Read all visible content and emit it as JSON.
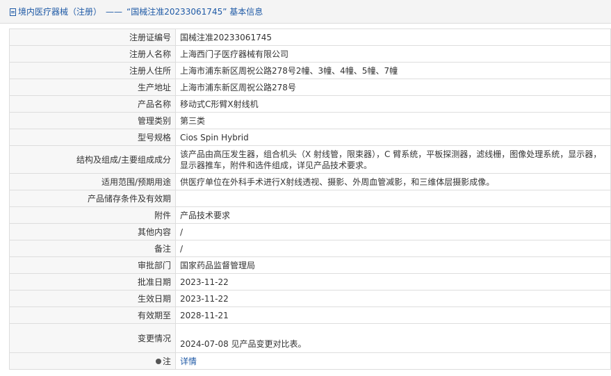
{
  "header": {
    "prefix": "境内医疗器械（注册）",
    "separator": "——",
    "title": "“国械注准20233061745” 基本信息"
  },
  "rows": [
    {
      "label": "注册证编号",
      "value": "国械注准20233061745"
    },
    {
      "label": "注册人名称",
      "value": "上海西门子医疗器械有限公司"
    },
    {
      "label": "注册人住所",
      "value": "上海市浦东新区周祝公路278号2幢、3幢、4幢、5幢、7幢"
    },
    {
      "label": "生产地址",
      "value": "上海市浦东新区周祝公路278号"
    },
    {
      "label": "产品名称",
      "value": "移动式C形臂X射线机"
    },
    {
      "label": "管理类别",
      "value": "第三类"
    },
    {
      "label": "型号规格",
      "value": "Cios Spin Hybrid"
    },
    {
      "label": "结构及组成/主要组成成分",
      "value": "该产品由高压发生器，组合机头（X 射线管，限束器），C 臂系统，平板探测器，滤线栅，图像处理系统，显示器，显示器推车，附件和选件组成，详见产品技术要求。"
    },
    {
      "label": "适用范围/预期用途",
      "value": "供医疗单位在外科手术进行X射线透视、摄影、外周血管减影，和三维体层摄影成像。"
    },
    {
      "label": "产品储存条件及有效期",
      "value": ""
    },
    {
      "label": "附件",
      "value": "产品技术要求"
    },
    {
      "label": "其他内容",
      "value": "/"
    },
    {
      "label": "备注",
      "value": "/"
    },
    {
      "label": "审批部门",
      "value": "国家药品监督管理局"
    },
    {
      "label": "批准日期",
      "value": "2023-11-22"
    },
    {
      "label": "生效日期",
      "value": "2023-11-22"
    },
    {
      "label": "有效期至",
      "value": "2028-11-21"
    },
    {
      "label": "变更情况",
      "value": "2024-07-08 见产品变更对比表。"
    }
  ],
  "note": {
    "label": "注",
    "link": "详情"
  }
}
